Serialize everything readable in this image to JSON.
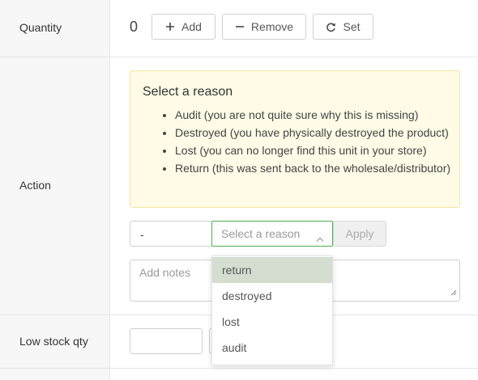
{
  "rows": {
    "quantity_label": "Quantity",
    "action_label": "Action",
    "low_stock_label": "Low stock qty"
  },
  "quantity": {
    "value": "0",
    "add_label": "Add",
    "remove_label": "Remove",
    "set_label": "Set"
  },
  "notice": {
    "title": "Select a reason",
    "items": [
      "Audit (you are not quite sure why this is missing)",
      "Destroyed (you have physically destroyed the product)",
      "Lost (you can no longer find this unit in your store)",
      "Return (this was sent back to the wholesale/distributor)"
    ]
  },
  "action": {
    "qty_value": "-",
    "reason_placeholder": "Select a reason",
    "apply_label": "Apply",
    "notes_placeholder": "Add notes",
    "reason_options": [
      "return",
      "destroyed",
      "lost",
      "audit"
    ]
  },
  "colors": {
    "focus_border": "#4caf50",
    "notice_bg": "#fffbe6",
    "active_option_bg": "#d4ddd0"
  }
}
